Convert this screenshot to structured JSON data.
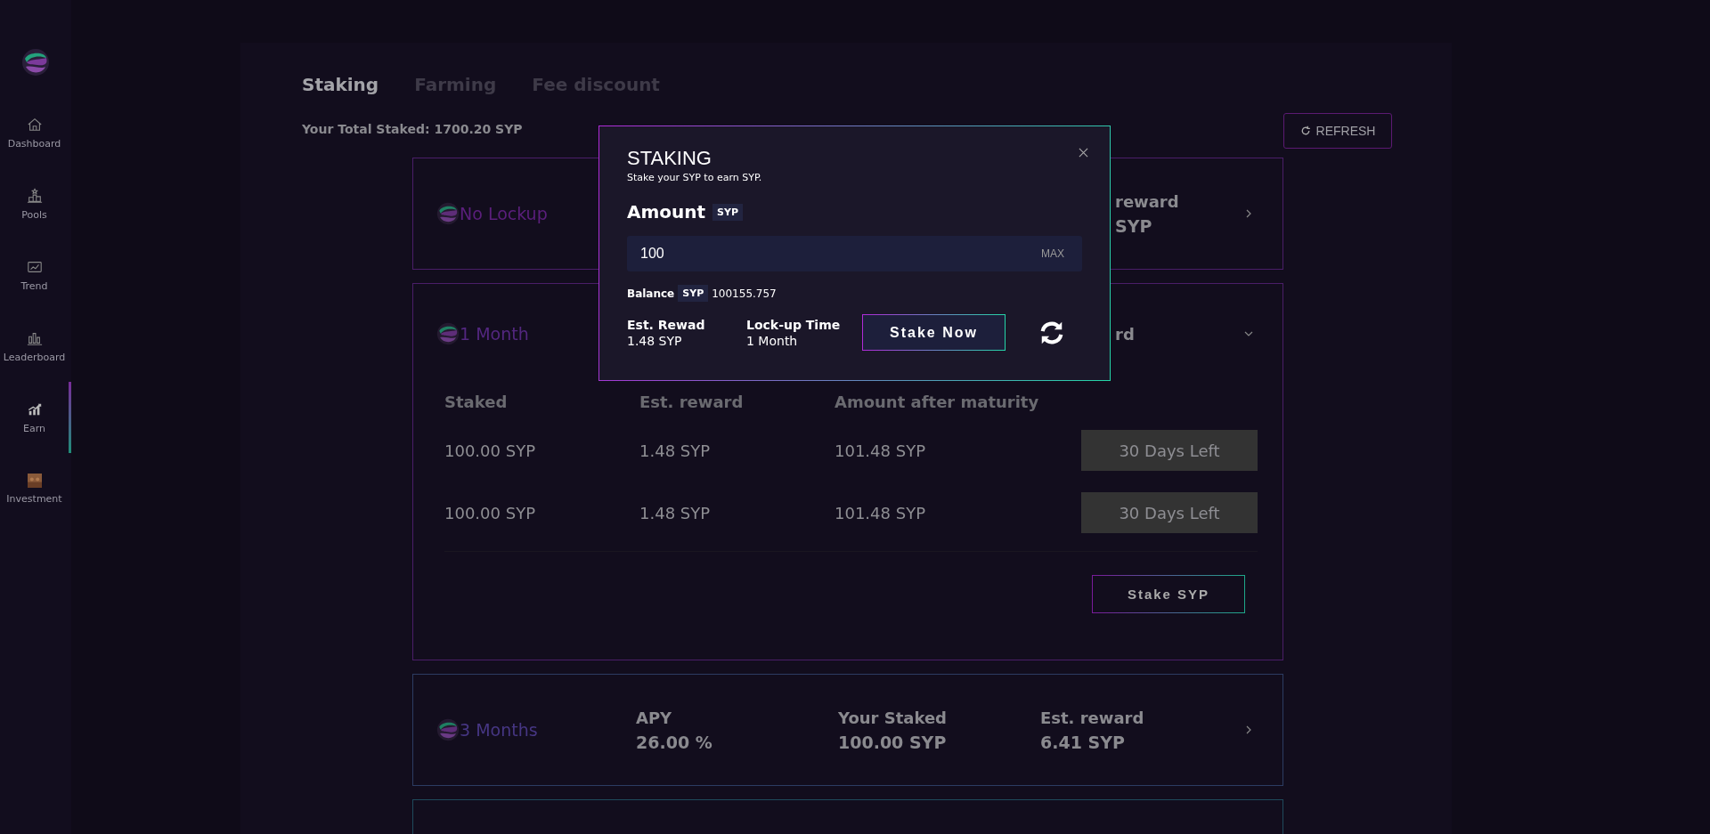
{
  "sidebar": {
    "items": [
      {
        "label": "Dashboard",
        "selected": false
      },
      {
        "label": "Pools",
        "selected": false
      },
      {
        "label": "Trend",
        "selected": false
      },
      {
        "label": "Leaderboard",
        "selected": false
      },
      {
        "label": "Earn",
        "selected": true
      },
      {
        "label": "Investment",
        "selected": false
      }
    ]
  },
  "tabs": [
    {
      "label": "Staking",
      "selected": true
    },
    {
      "label": "Farming",
      "selected": false
    },
    {
      "label": "Fee discount",
      "selected": false
    }
  ],
  "total_staked": "Your Total Staked: 1700.20 SYP",
  "refresh_button": "REFRESH",
  "pools": [
    {
      "name": "No Lockup",
      "expanded": false,
      "columns": [
        {
          "label": "reward",
          "value": "SYP",
          "partial": true
        }
      ]
    },
    {
      "name": "1 Month",
      "expanded": true,
      "columns": [
        {
          "label": "rd",
          "partial": true
        }
      ],
      "table": {
        "columns": [
          "Staked",
          "Est. reward",
          "Amount after maturity"
        ],
        "rows": [
          {
            "cells": [
              "100.00 SYP",
              "1.48 SYP",
              "101.48 SYP"
            ],
            "status": "30 Days Left"
          },
          {
            "cells": [
              "100.00 SYP",
              "1.48 SYP",
              "101.48 SYP"
            ],
            "status": "30 Days Left"
          }
        ]
      },
      "stake_button": "Stake SYP"
    },
    {
      "name": "3 Months",
      "expanded": false,
      "columns": [
        {
          "label": "APY",
          "value": "26.00 %"
        },
        {
          "label": "Your Staked",
          "value": "100.00 SYP"
        },
        {
          "label": "Est. reward",
          "value": "6.41 SYP"
        }
      ]
    },
    {
      "expanded": false,
      "cut": true
    }
  ],
  "modal": {
    "title": "STAKING",
    "subtitle": "Stake your SYP to earn SYP.",
    "amount_label": "Amount",
    "amount_unit": "SYP",
    "amount_value": "100",
    "max_button": "MAX",
    "balance_label": "Balance",
    "balance_unit": "SYP",
    "balance_value": "100155.757",
    "est_reward_label": "Est. Rewad",
    "est_reward_value": "1.48 SYP",
    "lockup_label": "Lock-up Time",
    "lockup_value": "1 Month",
    "stake_button": "Stake Now"
  }
}
